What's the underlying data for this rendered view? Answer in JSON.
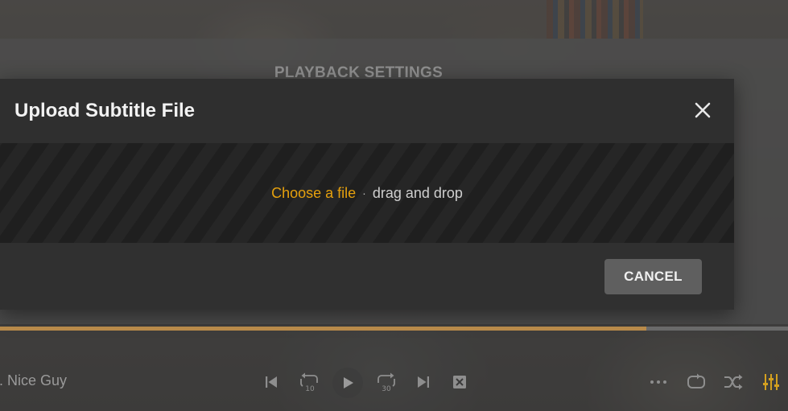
{
  "background": {
    "settings_title": "PLAYBACK SETTINGS"
  },
  "modal": {
    "title": "Upload Subtitle File",
    "close_icon": "close-icon",
    "dropzone": {
      "choose_label": "Choose a file",
      "separator": "·",
      "drag_label": "drag and drop"
    },
    "cancel_label": "CANCEL"
  },
  "player": {
    "media_title": "r. Nice Guy",
    "progress": 0.82,
    "controls": [
      "skip-previous-icon",
      "replay-10-icon",
      "play-icon",
      "forward-30-icon",
      "skip-next-icon",
      "stop-icon",
      "more-icon",
      "repeat-icon",
      "shuffle-icon",
      "equalizer-icon"
    ],
    "replay_label": "10",
    "forward_label": "30"
  },
  "colors": {
    "accent": "#e5a00d",
    "progress": "#b88a4a",
    "modal_bg": "#2d2d2d"
  }
}
